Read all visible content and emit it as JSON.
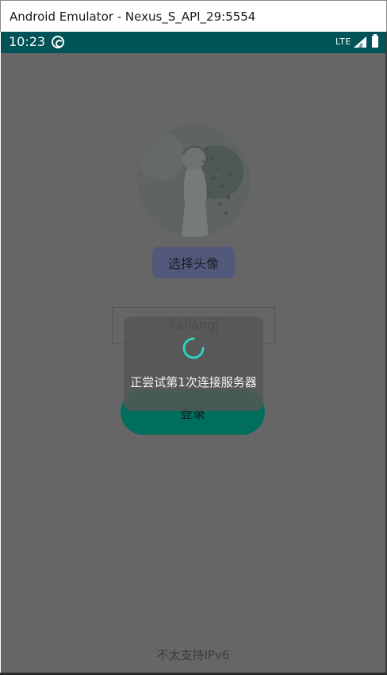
{
  "window": {
    "title": "Android Emulator - Nexus_S_API_29:5554"
  },
  "status_bar": {
    "time": "10:23",
    "network": "LTE",
    "icons": [
      "app-notification-icon",
      "signal-icon",
      "battery-icon"
    ],
    "color": "#005357"
  },
  "profile": {
    "avatar_icon": "avatar-image",
    "choose_avatar_label": "选择头像"
  },
  "login_form": {
    "username_value": "kailang",
    "login_label": "登录"
  },
  "loading_dialog": {
    "message": "正尝试第1次连接服务器",
    "spinner_icon": "loading-spinner-icon",
    "spinner_color": "#2ad3c0"
  },
  "footer": {
    "ipv6_status": "不太支持IPv6"
  },
  "colors": {
    "screen_dim": "#666666",
    "login_accent": "#006e5c",
    "button_secondary": "#52597a"
  }
}
